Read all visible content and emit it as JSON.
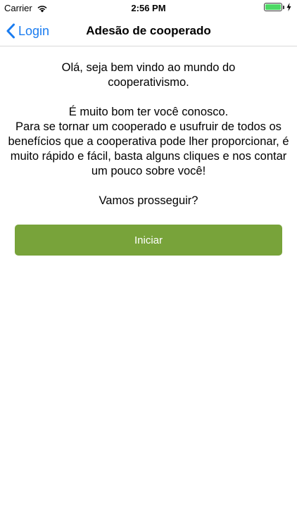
{
  "status_bar": {
    "carrier": "Carrier",
    "time": "2:56 PM",
    "battery_level": 1.0
  },
  "nav": {
    "back_label": "Login",
    "title": "Adesão de cooperado"
  },
  "content": {
    "greeting": "Olá, seja bem vindo ao mundo do cooperativismo.",
    "line_welcome": "É muito bom ter você conosco.",
    "body": "Para se tornar um cooperado e usufruir de todos os benefícios que a cooperativa pode lher proporcionar, é muito rápido e fácil, basta alguns cliques e nos contar um pouco sobre você!",
    "question": "Vamos prosseguir?"
  },
  "actions": {
    "start_label": "Iniciar"
  },
  "colors": {
    "accent_blue": "#1a7cf0",
    "button_green": "#78a33a",
    "battery_green": "#4cd964"
  }
}
